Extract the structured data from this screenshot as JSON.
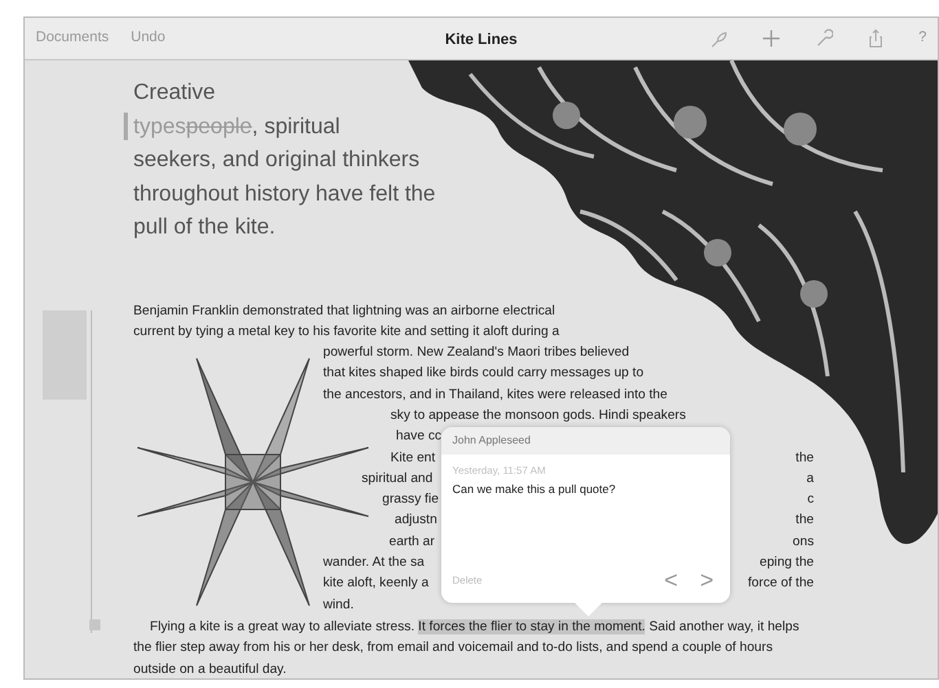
{
  "toolbar": {
    "left_buttons": [
      "Documents",
      "Undo"
    ],
    "title": "Kite Lines",
    "help": "?"
  },
  "pull_quote": {
    "lines": [
      [
        {
          "text": "Creative",
          "inserted": false,
          "deleted": false
        }
      ],
      [
        {
          "text": "types",
          "inserted": true,
          "deleted": false
        },
        {
          "text": "people",
          "inserted": false,
          "deleted": true
        },
        {
          "text": ", spiritual",
          "inserted": false,
          "deleted": false
        }
      ],
      [
        {
          "text": "seekers, and original thinkers",
          "inserted": false,
          "deleted": false
        }
      ],
      [
        {
          "text": "throughout history have felt the",
          "inserted": false,
          "deleted": false
        }
      ],
      [
        {
          "text": "pull of the kite.",
          "inserted": false,
          "deleted": false
        }
      ]
    ]
  },
  "body_lines": [
    {
      "left": "Benjamin Franklin demonstrated that lightning was an airborne electrical"
    },
    {
      "left": "current by tying a metal key to his favorite kite and setting it aloft during a"
    },
    {
      "left": "powerful storm. New Zealand's Maori tribes believed"
    },
    {
      "left": "that kites shaped like birds could carry messages up to"
    },
    {
      "left": "the ancestors, and in Thailand, kites were released into the"
    },
    {
      "left": "sky to appease the monsoon gods. Hindi speakers"
    },
    {
      "left": "have cc"
    },
    {
      "left": "Kite ent",
      "right": "the"
    },
    {
      "left": "spiritual and",
      "right": "a"
    },
    {
      "left": "grassy fie",
      "right": "c"
    },
    {
      "left": "adjustn",
      "right": "the"
    },
    {
      "left": "earth ar",
      "right": "ons"
    },
    {
      "left": "wander. At the sa",
      "right": "eping the"
    },
    {
      "left": "kite aloft, keenly a",
      "right": "force of the"
    },
    {
      "left": "wind."
    }
  ],
  "final_paragraph": [
    {
      "text": "Flying a kite is a great way to alleviate stress. ",
      "highlighted": false
    },
    {
      "text": "It forces the flier to stay in the moment.",
      "highlighted": true
    },
    {
      "text": " Said another way, it helps the flier step away from his or her desk, from email and voicemail and to-do lists, and spend a couple of hours outside on a beautiful day.",
      "highlighted": false
    }
  ],
  "comment": {
    "author": "John Appleseed",
    "time": "Yesterday, 11:57 AM",
    "text": "Can we make this a pull quote?",
    "delete": "Delete",
    "prev": "<",
    "next": ">"
  }
}
